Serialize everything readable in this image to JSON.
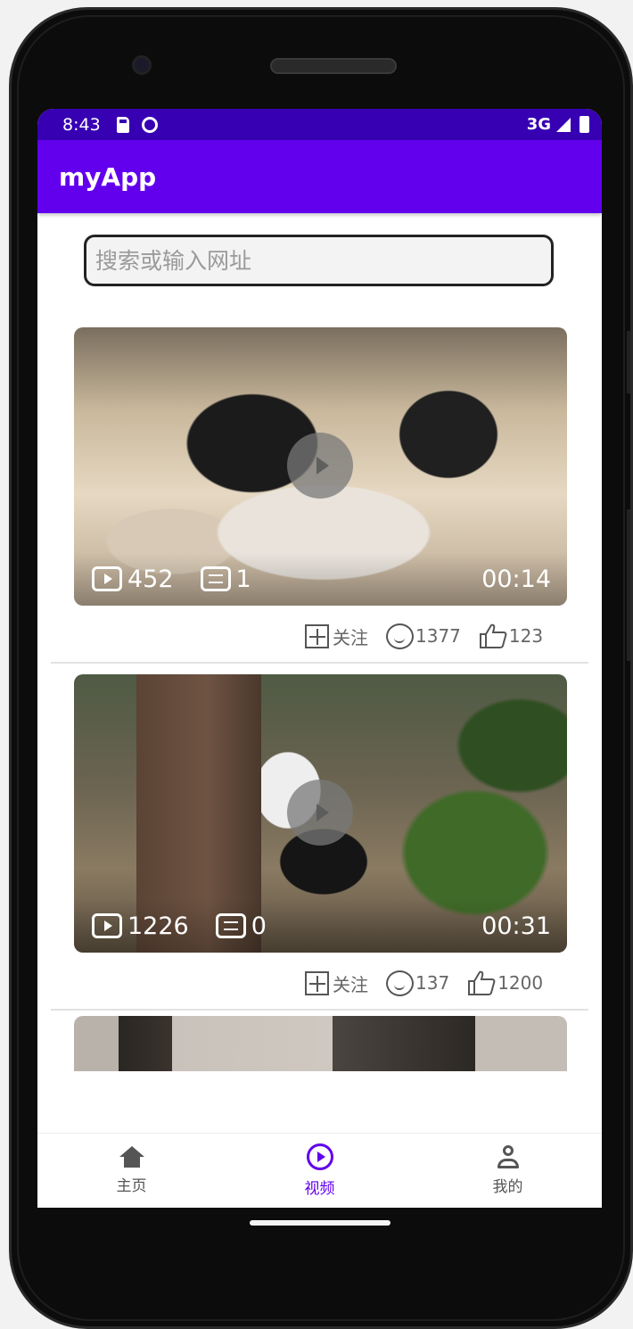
{
  "status_bar": {
    "time": "8:43",
    "network": "3G",
    "icons": [
      "sd-card-icon",
      "face-icon",
      "signal-icon",
      "battery-icon"
    ]
  },
  "app_bar": {
    "title": "myApp"
  },
  "search": {
    "placeholder": "搜索或输入网址",
    "value": ""
  },
  "videos": [
    {
      "plays": "452",
      "danmaku": "1",
      "duration": "00:14",
      "follow_label": "关注",
      "comments": "1377",
      "likes": "123"
    },
    {
      "plays": "1226",
      "danmaku": "0",
      "duration": "00:31",
      "follow_label": "关注",
      "comments": "137",
      "likes": "1200"
    }
  ],
  "bottom_nav": {
    "items": [
      {
        "label": "主页",
        "icon": "home-icon"
      },
      {
        "label": "视频",
        "icon": "play-circle-icon",
        "active": true
      },
      {
        "label": "我的",
        "icon": "person-icon"
      }
    ]
  },
  "colors": {
    "status_bar": "#3700b3",
    "app_bar": "#6200ee",
    "nav_active": "#6200ee"
  }
}
